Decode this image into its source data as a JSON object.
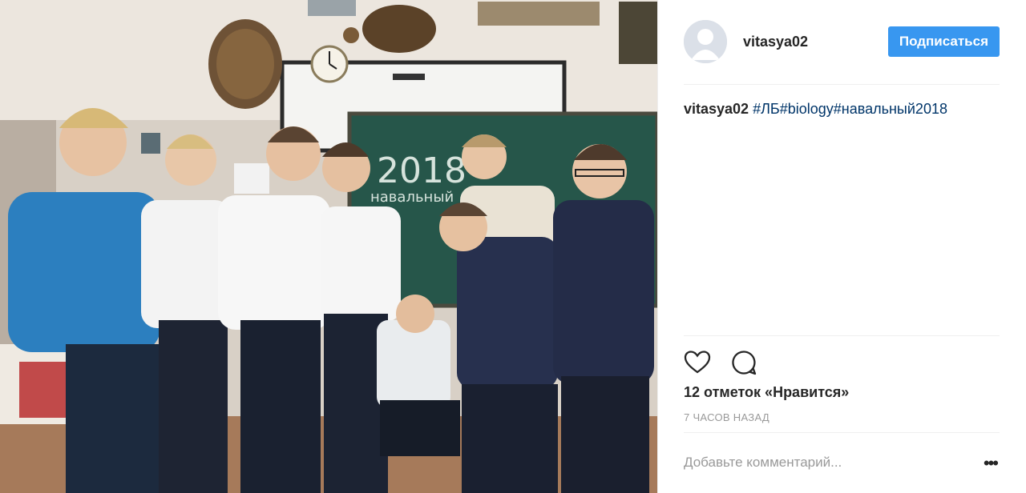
{
  "post": {
    "username": "vitasya02",
    "follow_label": "Подписаться",
    "caption_user": "vitasya02",
    "caption_tags": "#ЛБ#biology#навальный2018",
    "likes": "12 отметок «Нравится»",
    "time": "7 ЧАСОВ НАЗАД",
    "comment_placeholder": "Добавьте комментарий...",
    "more_label": "•••"
  },
  "photo": {
    "board_text_1": "2018",
    "board_text_2": "навальный"
  },
  "icons": [
    "heart-icon",
    "comment-icon",
    "more-options-icon"
  ],
  "colors": {
    "follow_button": "#3897f0",
    "hashtag": "#003569",
    "secondary_text": "#999999"
  }
}
